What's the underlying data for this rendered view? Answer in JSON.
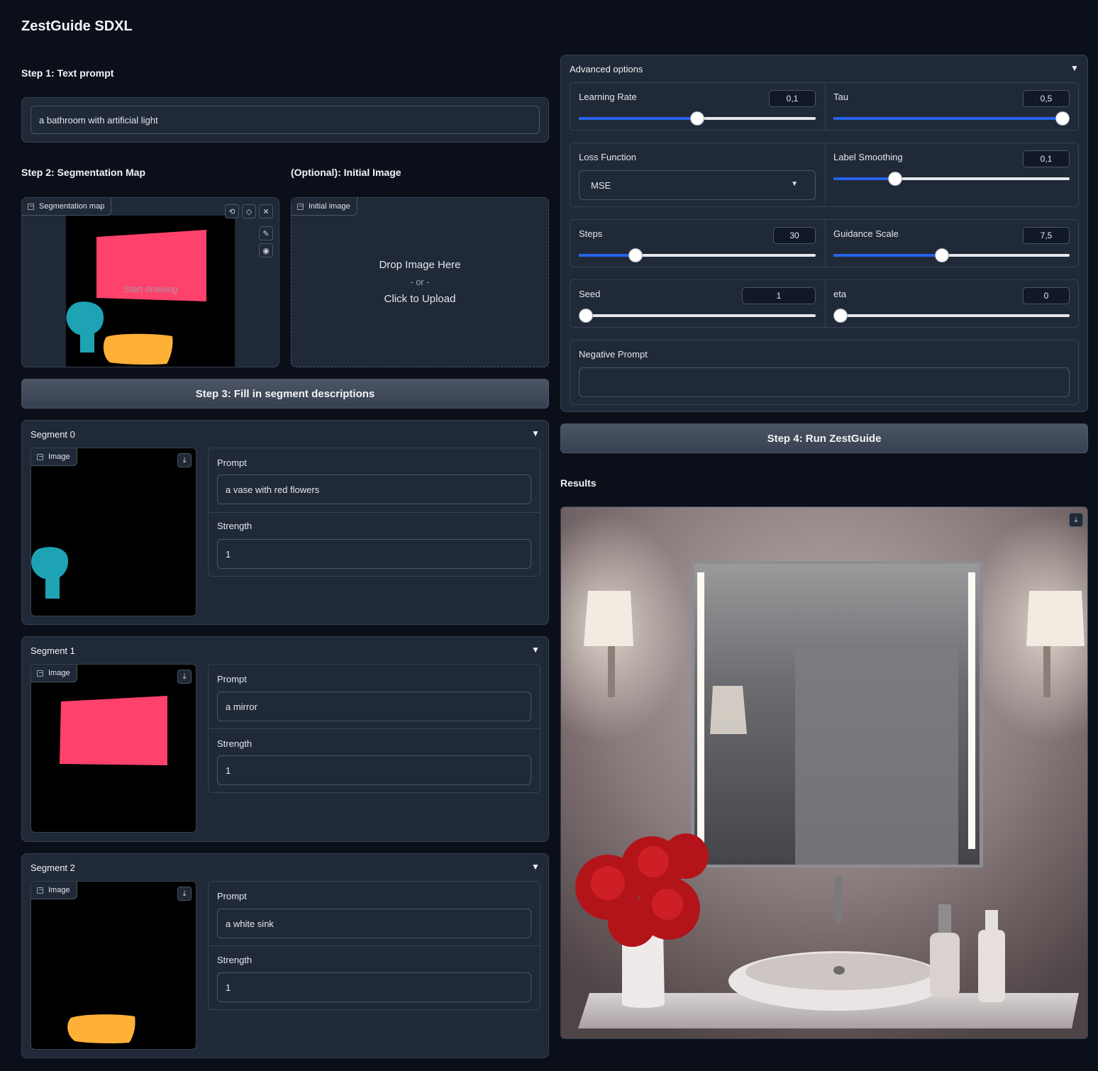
{
  "app": {
    "title": "ZestGuide SDXL"
  },
  "step1": {
    "label": "Step 1: Text prompt",
    "prompt_value": "a bathroom with artificial light"
  },
  "step2": {
    "label": "Step 2: Segmentation Map",
    "canvas_tag": "Segmentation map",
    "canvas_hint": "Start drawing",
    "colors": {
      "pink": "#ff426c",
      "teal": "#1ea3b5",
      "orange": "#ffb037"
    }
  },
  "initial": {
    "label": "(Optional): Initial Image",
    "tag": "Initial image",
    "drop_text": "Drop Image Here",
    "or_text": "- or -",
    "click_text": "Click to Upload"
  },
  "step3": {
    "button": "Step 3: Fill in segment descriptions"
  },
  "segments": [
    {
      "title": "Segment 0",
      "image_tag": "Image",
      "prompt_label": "Prompt",
      "prompt": "a vase with red flowers",
      "strength_label": "Strength",
      "strength": "1"
    },
    {
      "title": "Segment 1",
      "image_tag": "Image",
      "prompt_label": "Prompt",
      "prompt": "a mirror",
      "strength_label": "Strength",
      "strength": "1"
    },
    {
      "title": "Segment 2",
      "image_tag": "Image",
      "prompt_label": "Prompt",
      "prompt": "a white sink",
      "strength_label": "Strength",
      "strength": "1"
    }
  ],
  "advanced": {
    "title": "Advanced options",
    "learning_rate": {
      "label": "Learning Rate",
      "value": "0,1",
      "fraction": 0.5
    },
    "tau": {
      "label": "Tau",
      "value": "0,5",
      "fraction": 0.97
    },
    "loss_function": {
      "label": "Loss Function",
      "value": "MSE"
    },
    "label_smoothing": {
      "label": "Label Smoothing",
      "value": "0,1",
      "fraction": 0.26
    },
    "steps": {
      "label": "Steps",
      "value": "30",
      "fraction": 0.24
    },
    "guidance_scale": {
      "label": "Guidance Scale",
      "value": "7,5",
      "fraction": 0.46
    },
    "seed": {
      "label": "Seed",
      "value": "1",
      "fraction": 0.03
    },
    "eta": {
      "label": "eta",
      "value": "0",
      "fraction": 0.03
    },
    "negative_prompt": {
      "label": "Negative Prompt",
      "value": ""
    }
  },
  "step4": {
    "button": "Step 4: Run ZestGuide"
  },
  "results": {
    "label": "Results"
  },
  "icons": [
    "image-icon",
    "undo-icon",
    "eraser-icon",
    "close-icon",
    "brush-icon",
    "palette-icon",
    "download-icon",
    "chevron-down-icon",
    "dropdown-arrow-icon"
  ]
}
